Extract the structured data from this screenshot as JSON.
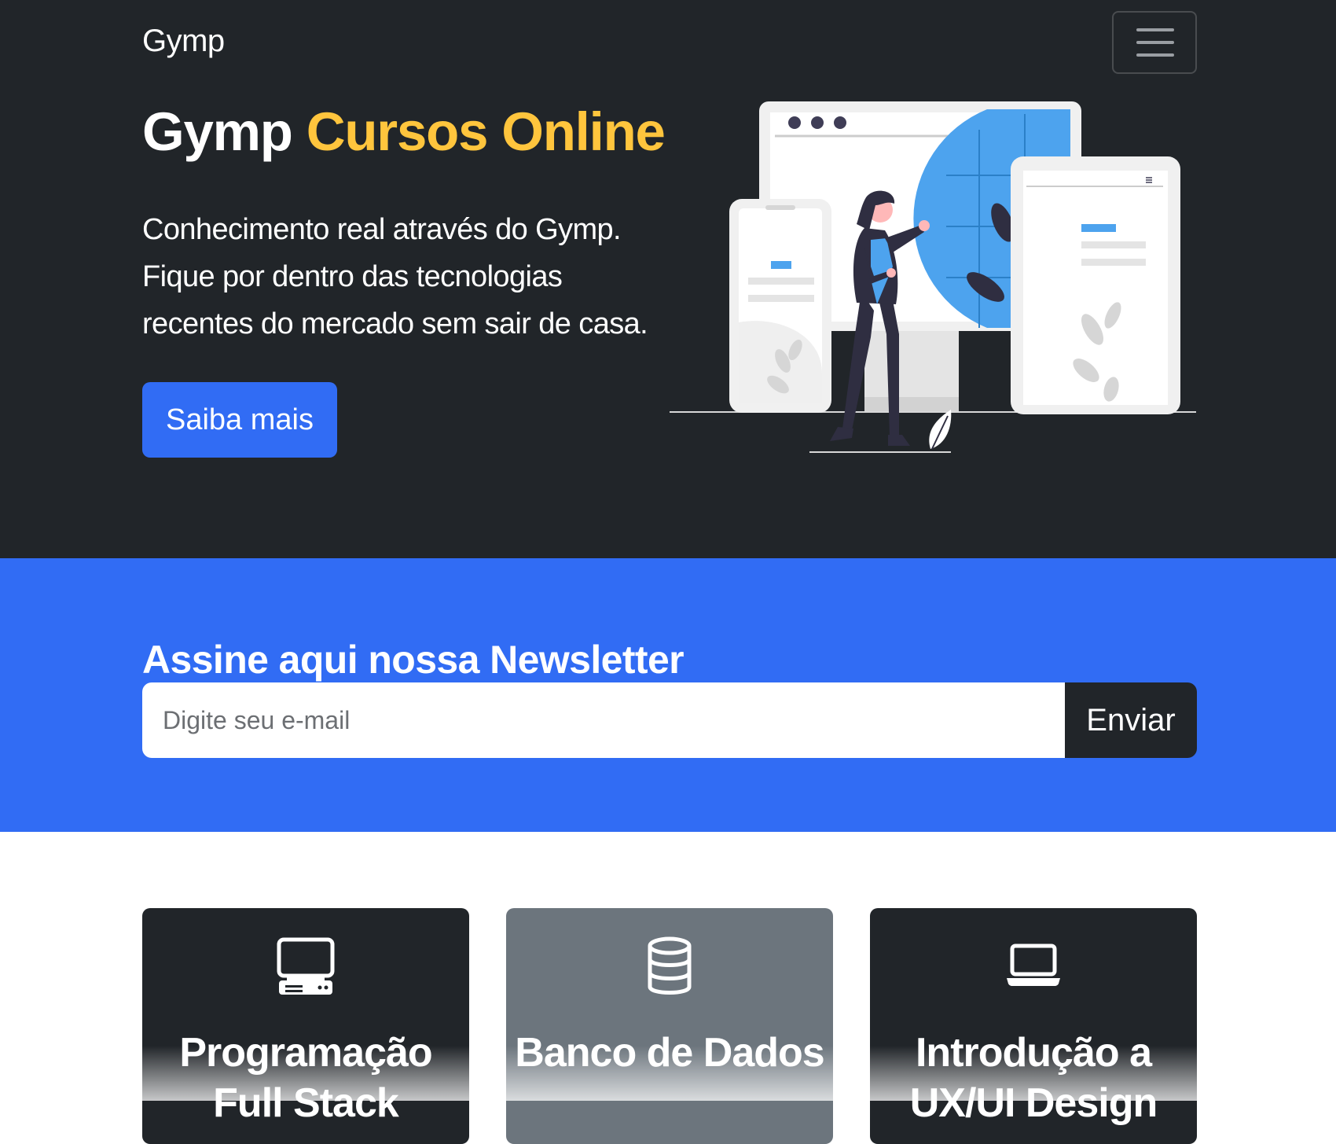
{
  "navbar": {
    "brand": "Gymp",
    "toggle_icon": "hamburger-icon"
  },
  "hero": {
    "title_main": "Gymp",
    "title_accent": "Cursos Online",
    "text_lines": [
      "Conhecimento real através do Gymp.",
      "Fique por dentro das tecnologias",
      "recentes do mercado sem sair de casa."
    ],
    "cta_label": "Saiba mais",
    "illustration": "web-devices-illustration"
  },
  "newsletter": {
    "title": "Assine aqui nossa Newsletter",
    "input_placeholder": "Digite seu e-mail",
    "input_value": "",
    "submit_label": "Enviar"
  },
  "courses": [
    {
      "icon": "pc-display-icon",
      "title": "Programação Full Stack",
      "theme": "dark"
    },
    {
      "icon": "database-icon",
      "title": "Banco de Dados",
      "theme": "gray"
    },
    {
      "icon": "laptop-icon",
      "title": "Introdução a UX/UI Design",
      "theme": "dark"
    }
  ],
  "colors": {
    "dark": "#212529",
    "primary": "#316cf4",
    "accent": "#ffc53d",
    "card_gray": "#6c757d",
    "illustration_blue": "#4da3ee"
  }
}
